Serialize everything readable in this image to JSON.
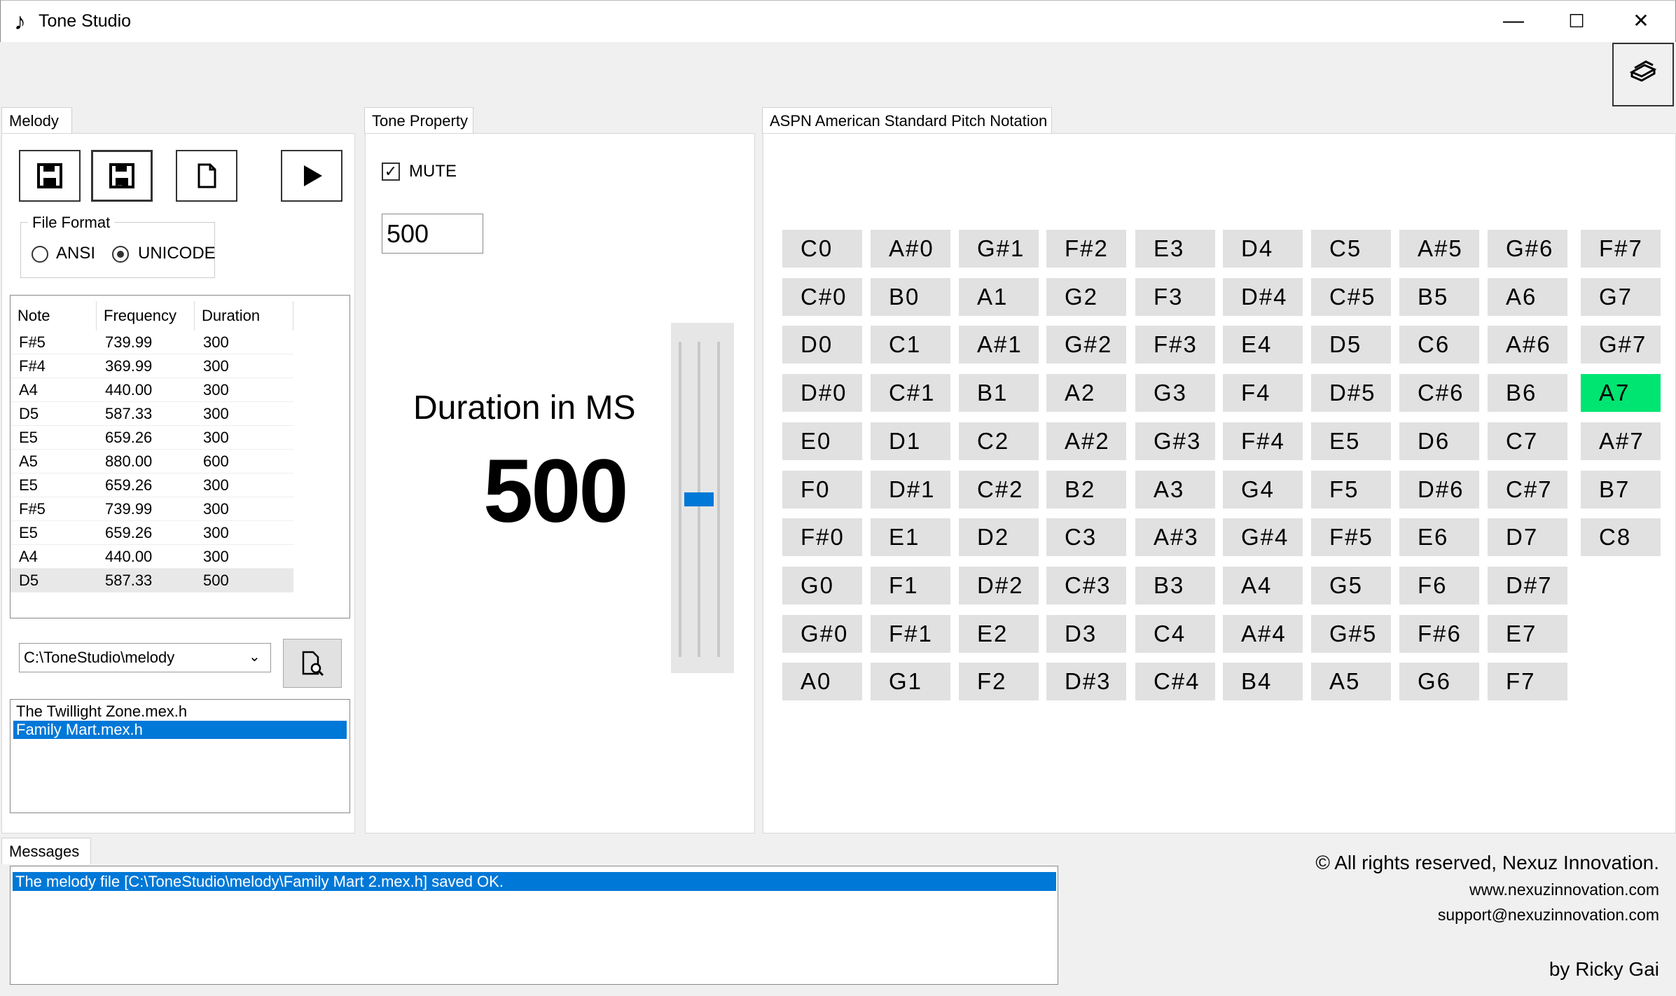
{
  "window": {
    "title": "Tone Studio",
    "controls": {
      "minimize": "—",
      "maximize": "☐",
      "close": "✕"
    }
  },
  "help_button": {
    "icon": "book-icon"
  },
  "melody": {
    "tab_label": "Melody",
    "toolbar_icons": [
      "save-icon",
      "save-as-icon",
      "new-file-icon",
      "play-icon"
    ],
    "file_format": {
      "legend": "File Format",
      "options": [
        {
          "label": "ANSI",
          "checked": false
        },
        {
          "label": "UNICODE",
          "checked": true
        }
      ]
    },
    "table": {
      "headers": [
        "Note",
        "Frequency",
        "Duration"
      ],
      "rows": [
        [
          "F#5",
          "739.99",
          "300"
        ],
        [
          "F#4",
          "369.99",
          "300"
        ],
        [
          "A4",
          "440.00",
          "300"
        ],
        [
          "D5",
          "587.33",
          "300"
        ],
        [
          "E5",
          "659.26",
          "300"
        ],
        [
          "A5",
          "880.00",
          "600"
        ],
        [
          "E5",
          "659.26",
          "300"
        ],
        [
          "F#5",
          "739.99",
          "300"
        ],
        [
          "E5",
          "659.26",
          "300"
        ],
        [
          "A4",
          "440.00",
          "300"
        ],
        [
          "D5",
          "587.33",
          "500"
        ]
      ],
      "selected_row": 10
    },
    "path": "C:\\ToneStudio\\melody",
    "files": [
      "The Twillight Zone.mex.h",
      "Family Mart.mex.h"
    ],
    "selected_file": 1
  },
  "tone_property": {
    "tab_label": "Tone Property",
    "mute_label": "MUTE",
    "mute_checked": true,
    "duration_input": "500",
    "duration_caption": "Duration in MS",
    "duration_value": "500",
    "slider_level_fraction": 0.5
  },
  "aspn": {
    "tab_label": "ASPN American Standard Pitch Notation",
    "active_note": "A7",
    "columns": [
      [
        "C0",
        "C#0",
        "D0",
        "D#0",
        "E0",
        "F0",
        "F#0",
        "G0",
        "G#0",
        "A0"
      ],
      [
        "A#0",
        "B0",
        "C1",
        "C#1",
        "D1",
        "D#1",
        "E1",
        "F1",
        "F#1",
        "G1"
      ],
      [
        "G#1",
        "A1",
        "A#1",
        "B1",
        "C2",
        "C#2",
        "D2",
        "D#2",
        "E2",
        "F2"
      ],
      [
        "F#2",
        "G2",
        "G#2",
        "A2",
        "A#2",
        "B2",
        "C3",
        "C#3",
        "D3",
        "D#3"
      ],
      [
        "E3",
        "F3",
        "F#3",
        "G3",
        "G#3",
        "A3",
        "A#3",
        "B3",
        "C4",
        "C#4"
      ],
      [
        "D4",
        "D#4",
        "E4",
        "F4",
        "F#4",
        "G4",
        "G#4",
        "A4",
        "A#4",
        "B4"
      ],
      [
        "C5",
        "C#5",
        "D5",
        "D#5",
        "E5",
        "F5",
        "F#5",
        "G5",
        "G#5",
        "A5"
      ],
      [
        "A#5",
        "B5",
        "C6",
        "C#6",
        "D6",
        "D#6",
        "E6",
        "F6",
        "F#6",
        "G6"
      ],
      [
        "G#6",
        "A6",
        "A#6",
        "B6",
        "C7",
        "C#7",
        "D7",
        "D#7",
        "E7",
        "F7"
      ],
      [
        "F#7",
        "G7",
        "G#7",
        "A7",
        "A#7",
        "B7",
        "C8"
      ]
    ]
  },
  "messages": {
    "tab_label": "Messages",
    "items": [
      "The melody file [C:\\ToneStudio\\melody\\Family Mart 2.mex.h] saved OK."
    ]
  },
  "footer": {
    "copyright": "© All rights reserved, Nexuz Innovation.",
    "website": "www.nexuzinnovation.com",
    "email": "support@nexuzinnovation.com",
    "byline": "by Ricky Gai"
  },
  "colors": {
    "accent": "#0078d7",
    "active_note": "#00e472",
    "note_button": "#e1e1e1"
  }
}
